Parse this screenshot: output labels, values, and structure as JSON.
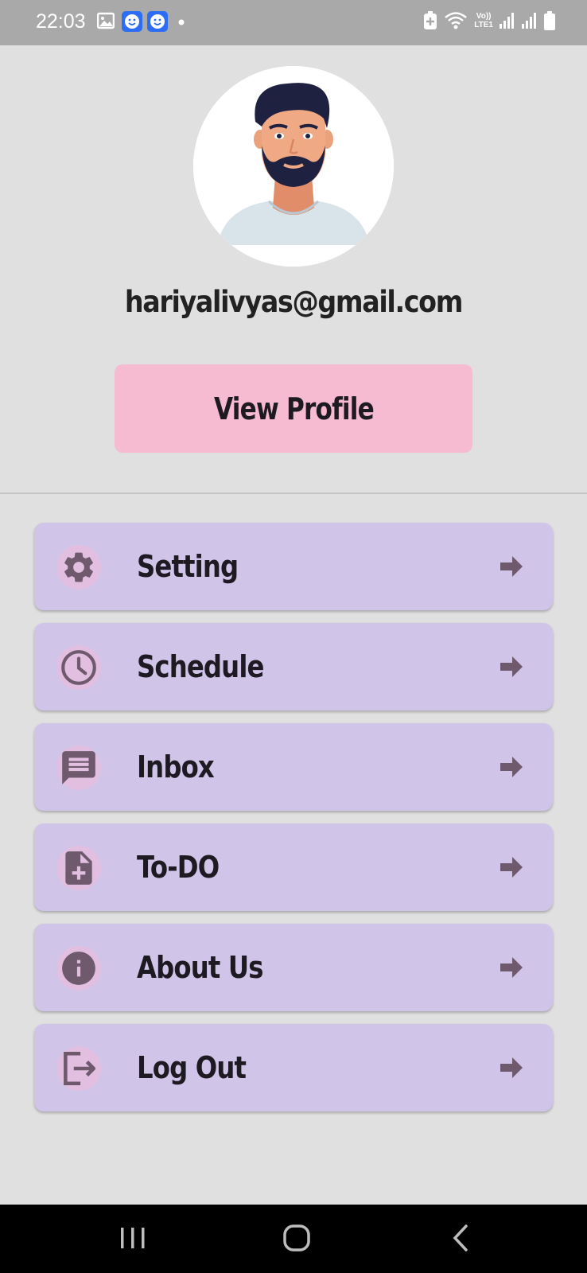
{
  "status_bar": {
    "time": "22:03",
    "left_icons": [
      "image-icon",
      "smiley-app-icon",
      "smiley-app-icon",
      "dot-icon"
    ],
    "right_icons": [
      "battery-saver-icon",
      "wifi-icon",
      "volte-icon",
      "signal-icon",
      "signal-icon",
      "battery-icon"
    ],
    "volte_text": "Vo))",
    "lte_text": "LTE1"
  },
  "profile": {
    "email": "hariyalivyas@gmail.com",
    "view_profile_label": "View Profile"
  },
  "menu": {
    "items": [
      {
        "label": "Setting",
        "icon": "gear-icon"
      },
      {
        "label": "Schedule",
        "icon": "clock-icon"
      },
      {
        "label": "Inbox",
        "icon": "message-icon"
      },
      {
        "label": "To-DO",
        "icon": "note-add-icon"
      },
      {
        "label": "About Us",
        "icon": "info-icon"
      },
      {
        "label": "Log Out",
        "icon": "logout-icon"
      }
    ],
    "arrow_icon": "arrow-right-icon"
  },
  "colors": {
    "background": "#e0e0e0",
    "status_bar": "#a9a9a9",
    "view_profile_button": "#f7bbd1",
    "menu_item": "#d1c4e9",
    "icon_color": "#6e5a6c",
    "icon_circle": "#e2bfe0",
    "nav_bar": "#000000"
  },
  "nav_bar": {
    "buttons": [
      "recent-apps-icon",
      "home-icon",
      "back-icon"
    ]
  }
}
